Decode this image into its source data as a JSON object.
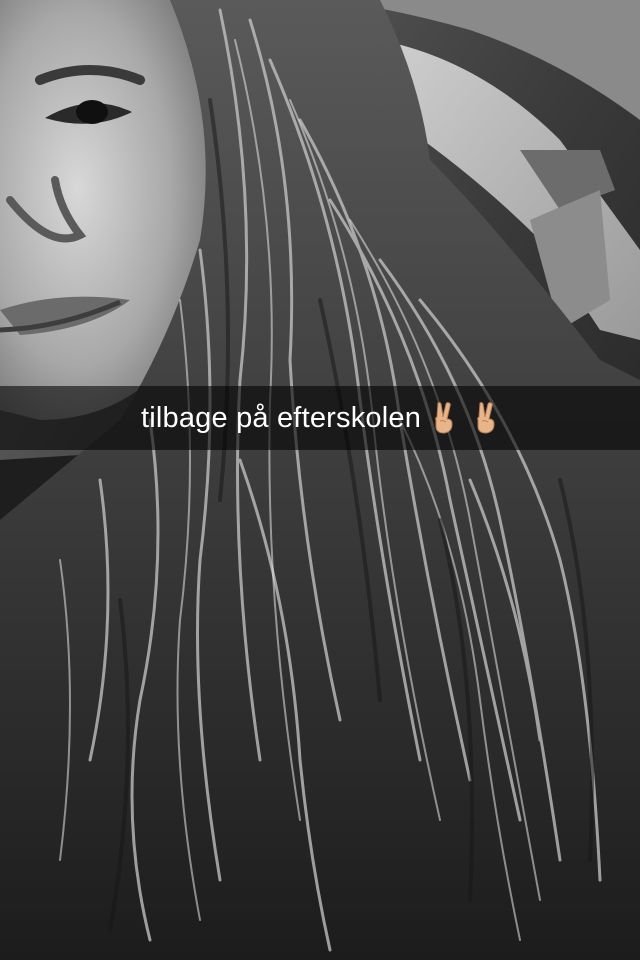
{
  "snap": {
    "caption": "tilbage på efterskolen",
    "caption_icons": [
      "victory-hand-icon",
      "victory-hand-icon"
    ]
  },
  "photo": {
    "filter": "black-and-white"
  },
  "colors": {
    "caption_bar": "#000000",
    "caption_text": "#ffffff",
    "emoji_skin": "#e8b48a"
  }
}
